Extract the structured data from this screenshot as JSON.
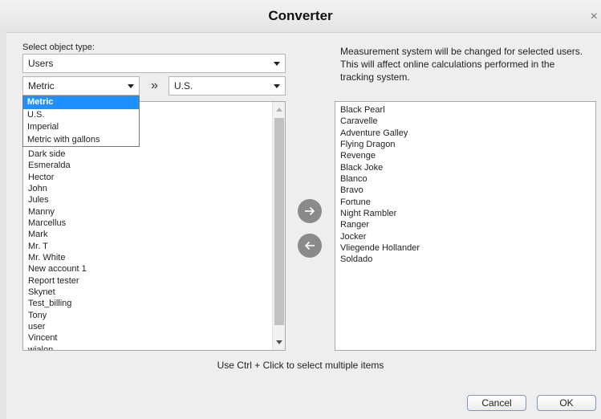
{
  "dialog": {
    "title": "Converter",
    "close_glyph": "×"
  },
  "object_type": {
    "label": "Select object type:",
    "value": "Users"
  },
  "units": {
    "from_value": "Metric",
    "arrow_glyph": "»",
    "to_value": "U.S.",
    "options": [
      "Metric",
      "U.S.",
      "Imperial",
      "Metric with gallons"
    ],
    "selected_option": "Metric"
  },
  "info_text": "Measurement system will be changed for selected users. This will affect online calculations performed in the tracking system.",
  "left_list": {
    "items": [
      "Dark side",
      "Esmeralda",
      "Hector",
      "John",
      "Jules",
      "Manny",
      "Marcellus",
      "Mark",
      "Mr. T",
      "Mr. White",
      "New account 1",
      "Report tester",
      "Skynet",
      "Test_billing",
      "Tony",
      "user",
      "Vincent",
      "wialon"
    ]
  },
  "right_list": {
    "items": [
      "Black Pearl",
      "Caravelle",
      "Adventure Galley",
      "Flying Dragon",
      "Revenge",
      "Black Joke",
      "Blanco",
      "Bravo",
      "Fortune",
      "Night Rambler",
      "Ranger",
      "Jocker",
      "Vliegende Hollander",
      "Soldado"
    ]
  },
  "hint": "Use Ctrl + Click to select multiple items",
  "buttons": {
    "cancel": "Cancel",
    "ok": "OK",
    "move_right_icon": "arrow-right-icon",
    "move_left_icon": "arrow-left-icon"
  },
  "colors": {
    "selected_option_bg": "#1e90ff",
    "arrow_button_bg": "#8a8a8a",
    "button_border": "#7d97b5"
  }
}
